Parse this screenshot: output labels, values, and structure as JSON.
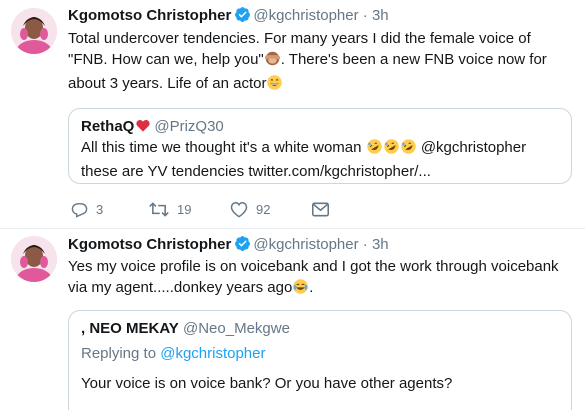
{
  "tweets": [
    {
      "author_name": "Kgomotso Christopher",
      "author_handle": "@kgchristopher",
      "dot": "·",
      "time": "3h",
      "text_before": "Total undercover tendencies. For many years I did the female voice of \"FNB. How can we, help you\"",
      "text_middle": ". There's been a new FNB voice now for about 3 years. Life of an actor",
      "emoji_1": "see-no-evil-monkey-icon",
      "emoji_2": "grinning-face-icon",
      "quote": {
        "author_name": "RethaQ",
        "author_handle": "@PrizQ30",
        "text_before": "All this time we thought it's a white woman ",
        "text_after": " @kgchristopher these are YV tendencies twitter.com/kgchristopher/..."
      },
      "actions": {
        "reply_count": "3",
        "retweet_count": "19",
        "like_count": "92"
      }
    },
    {
      "author_name": "Kgomotso Christopher",
      "author_handle": "@kgchristopher",
      "dot": "·",
      "time": "3h",
      "text_before": "Yes my voice profile is on voicebank and I got the work through voicebank via my agent.....donkey years ago",
      "text_after": ".",
      "quote": {
        "author_name": ", NEO MEKAY",
        "author_handle": "@Neo_Mekgwe",
        "replying_prefix": "Replying to ",
        "replying_to": "@kgchristopher",
        "text": "Your voice is on voice bank? Or you have other agents?"
      }
    }
  ],
  "colors": {
    "accent": "#1da1f2",
    "muted": "#657786",
    "border": "#ccd6dd",
    "text": "#14171a"
  }
}
